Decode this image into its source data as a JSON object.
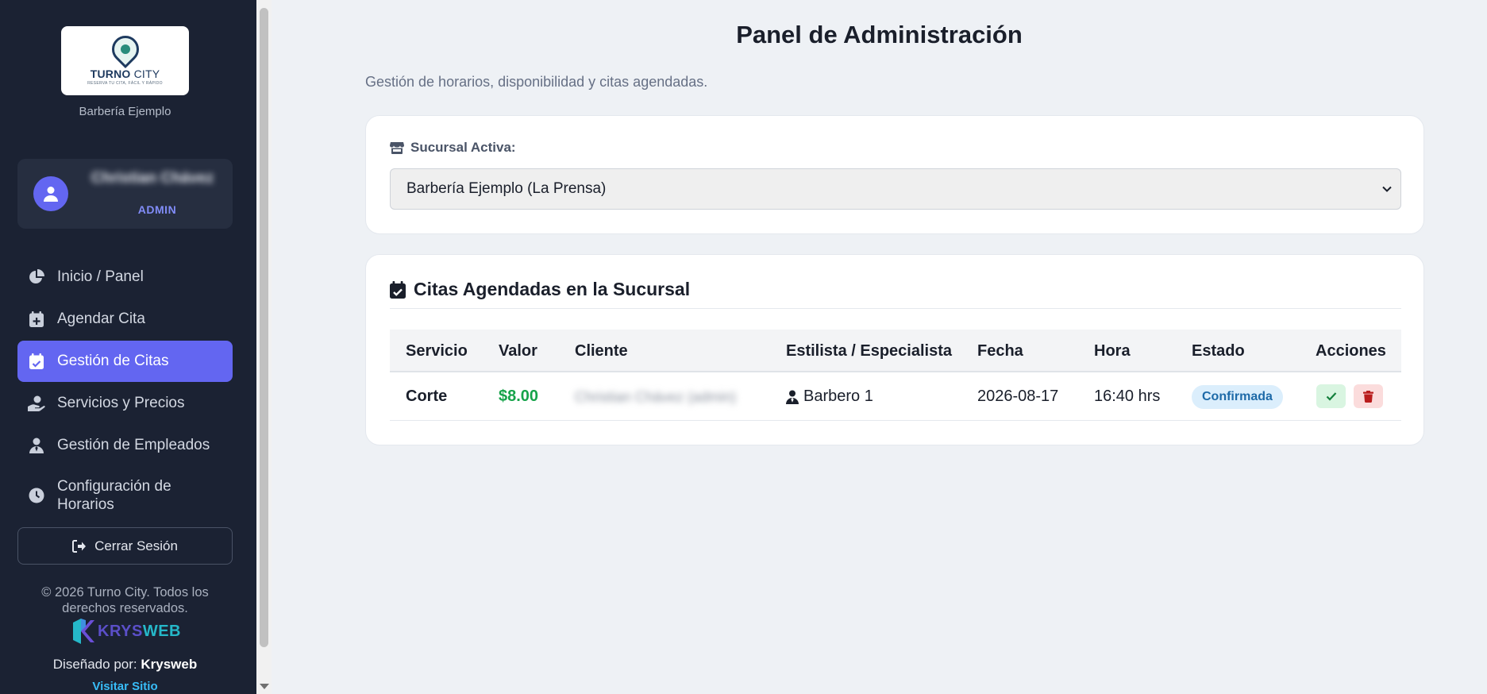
{
  "sidebar": {
    "logo": {
      "brand_main": "TURNO",
      "brand_city": "CITY",
      "tagline": "RESERVA TU CITA, FÁCIL Y RÁPIDO"
    },
    "business_name": "Barbería Ejemplo",
    "user": {
      "name": "Christian Chávez",
      "role": "ADMIN"
    },
    "nav": [
      {
        "label": "Inicio / Panel",
        "icon": "chart-pie-icon"
      },
      {
        "label": "Agendar Cita",
        "icon": "calendar-plus-icon"
      },
      {
        "label": "Gestión de Citas",
        "icon": "calendar-check-icon",
        "active": true
      },
      {
        "label": "Servicios y Precios",
        "icon": "hand-holding-dollar-icon"
      },
      {
        "label": "Gestión de Empleados",
        "icon": "user-tie-icon"
      },
      {
        "label": "Configuración de Horarios",
        "icon": "clock-icon"
      }
    ],
    "logout_label": "Cerrar Sesión",
    "copyright": "© 2026 Turno City. Todos los derechos reservados.",
    "krysweb": {
      "k1": "KRYS",
      "k2": "WEB"
    },
    "designed_prefix": "Diseñado por:",
    "designed_by": "Krysweb",
    "visit_label": "Visitar Sitio"
  },
  "main": {
    "title": "Panel de Administración",
    "subtitle": "Gestión de horarios, disponibilidad y citas agendadas.",
    "branch": {
      "label": "Sucursal Activa:",
      "selected": "Barbería Ejemplo (La Prensa)"
    },
    "appointments": {
      "title": "Citas Agendadas en la Sucursal",
      "columns": [
        "Servicio",
        "Valor",
        "Cliente",
        "Estilista / Especialista",
        "Fecha",
        "Hora",
        "Estado",
        "Acciones"
      ],
      "rows": [
        {
          "service": "Corte",
          "price": "$8.00",
          "client": "Christian Chávez (admin)",
          "stylist": "Barbero 1",
          "date": "2026-08-17",
          "time": "16:40 hrs",
          "status": "Confirmada"
        }
      ]
    }
  },
  "colors": {
    "sidebar_bg": "#1b2233",
    "accent": "#6366f1",
    "price": "#16a34a",
    "status_badge_bg": "#dbeefc",
    "status_badge_text": "#1e6aa8"
  }
}
